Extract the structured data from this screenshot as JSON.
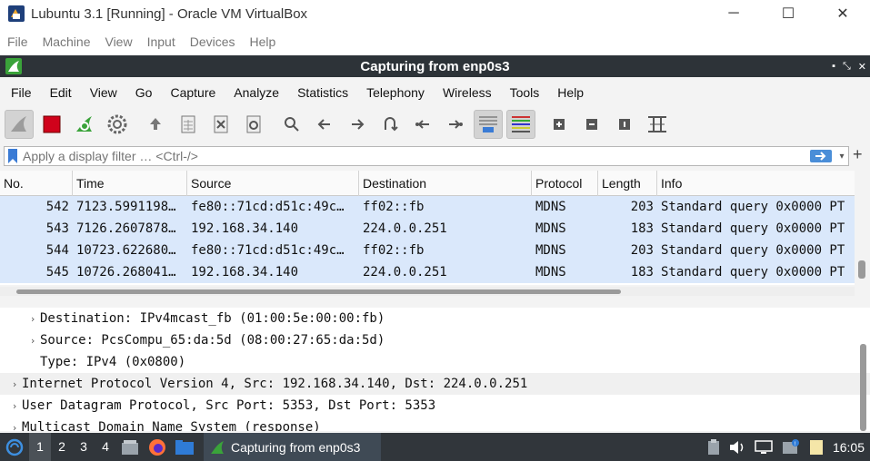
{
  "vbox": {
    "title": "Lubuntu 3.1 [Running] - Oracle VM VirtualBox",
    "menu": [
      "File",
      "Machine",
      "View",
      "Input",
      "Devices",
      "Help"
    ]
  },
  "wireshark": {
    "title": "Capturing from enp0s3",
    "menu": [
      "File",
      "Edit",
      "View",
      "Go",
      "Capture",
      "Analyze",
      "Statistics",
      "Telephony",
      "Wireless",
      "Tools",
      "Help"
    ],
    "filter_placeholder": "Apply a display filter … <Ctrl-/>",
    "columns": [
      "No.",
      "Time",
      "Source",
      "Destination",
      "Protocol",
      "Length",
      "Info"
    ],
    "packets": [
      {
        "no": "542",
        "time": "7123.5991198…",
        "src": "fe80::71cd:d51c:49c…",
        "dst": "ff02::fb",
        "proto": "MDNS",
        "len": "203",
        "info": "Standard query 0x0000 PT"
      },
      {
        "no": "543",
        "time": "7126.2607878…",
        "src": "192.168.34.140",
        "dst": "224.0.0.251",
        "proto": "MDNS",
        "len": "183",
        "info": "Standard query 0x0000 PT"
      },
      {
        "no": "544",
        "time": "10723.622680…",
        "src": "fe80::71cd:d51c:49c…",
        "dst": "ff02::fb",
        "proto": "MDNS",
        "len": "203",
        "info": "Standard query 0x0000 PT"
      },
      {
        "no": "545",
        "time": "10726.268041…",
        "src": "192.168.34.140",
        "dst": "224.0.0.251",
        "proto": "MDNS",
        "len": "183",
        "info": "Standard query 0x0000 PT"
      }
    ],
    "details": [
      {
        "text": "Destination: IPv4mcast_fb (01:00:5e:00:00:fb)",
        "level": 1,
        "arrow": "›"
      },
      {
        "text": "Source: PcsCompu_65:da:5d (08:00:27:65:da:5d)",
        "level": 1,
        "arrow": "›"
      },
      {
        "text": "Type: IPv4 (0x0800)",
        "level": 1,
        "arrow": ""
      },
      {
        "text": "Internet Protocol Version 4, Src: 192.168.34.140, Dst: 224.0.0.251",
        "level": 0,
        "arrow": "›"
      },
      {
        "text": "User Datagram Protocol, Src Port: 5353, Dst Port: 5353",
        "level": 0,
        "arrow": "›"
      },
      {
        "text": "Multicast Domain Name System (response)",
        "level": 0,
        "arrow": "›"
      }
    ]
  },
  "taskbar": {
    "workspaces": [
      "1",
      "2",
      "3",
      "4"
    ],
    "active_app": "Capturing from enp0s3",
    "clock": "16:05"
  },
  "colors": {
    "titlebar": "#2d3338",
    "selected_row": "#dae8fb",
    "taskbar": "#31363b",
    "shark_green": "#3aa33a"
  }
}
